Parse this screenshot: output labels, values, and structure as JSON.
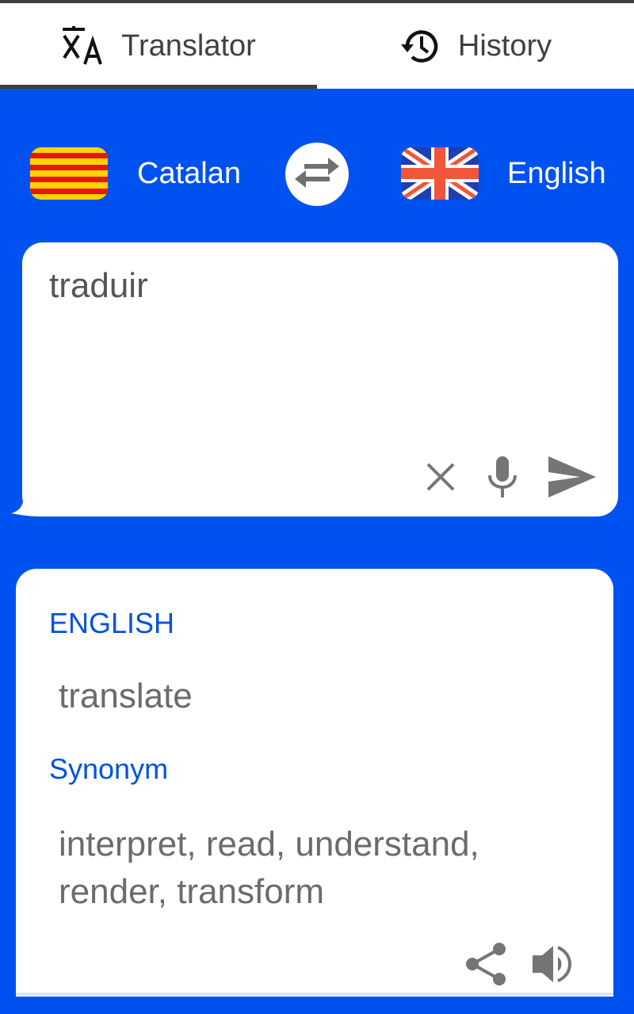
{
  "tabs": [
    {
      "label": "Translator",
      "icon": "translate-icon",
      "active": true
    },
    {
      "label": "History",
      "icon": "history-icon",
      "active": false
    }
  ],
  "languages": {
    "source": {
      "name": "Catalan",
      "flag": "catalonia-flag-icon"
    },
    "target": {
      "name": "English",
      "flag": "uk-flag-icon"
    },
    "swap_icon": "swap-arrows-icon"
  },
  "input": {
    "value": "traduir",
    "actions": [
      "clear-icon",
      "microphone-icon",
      "send-icon"
    ]
  },
  "output": {
    "language_label": "ENGLISH",
    "translation": "translate",
    "synonym_label": "Synonym",
    "synonyms": "interpret, read, understand, render, transform",
    "actions": [
      "share-icon",
      "speaker-icon"
    ]
  },
  "colors": {
    "primary_blue": "#0052f0",
    "accent_text": "#0052e0",
    "icon_gray": "#757575"
  }
}
